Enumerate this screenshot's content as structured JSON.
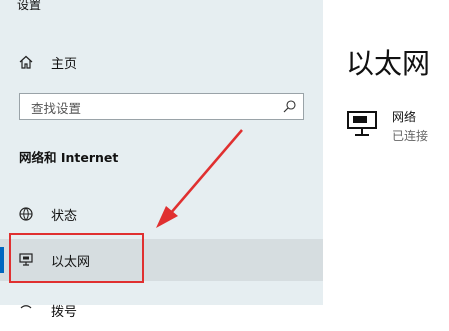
{
  "app": {
    "title": "设置"
  },
  "sidebar": {
    "home_label": "主页",
    "search_placeholder": "查找设置",
    "section_heading": "网络和 Internet",
    "items": [
      {
        "label": "状态",
        "icon": "globe-icon"
      },
      {
        "label": "以太网",
        "icon": "ethernet-icon",
        "selected": true
      },
      {
        "label": "拨号",
        "icon": "dialup-icon"
      }
    ]
  },
  "main": {
    "heading": "以太网",
    "network": {
      "name": "网络",
      "status": "已连接",
      "icon": "ethernet-icon"
    }
  },
  "colors": {
    "accent": "#0067c0",
    "annotation": "#e03030",
    "sidebar_bg": "#e6eef1"
  }
}
